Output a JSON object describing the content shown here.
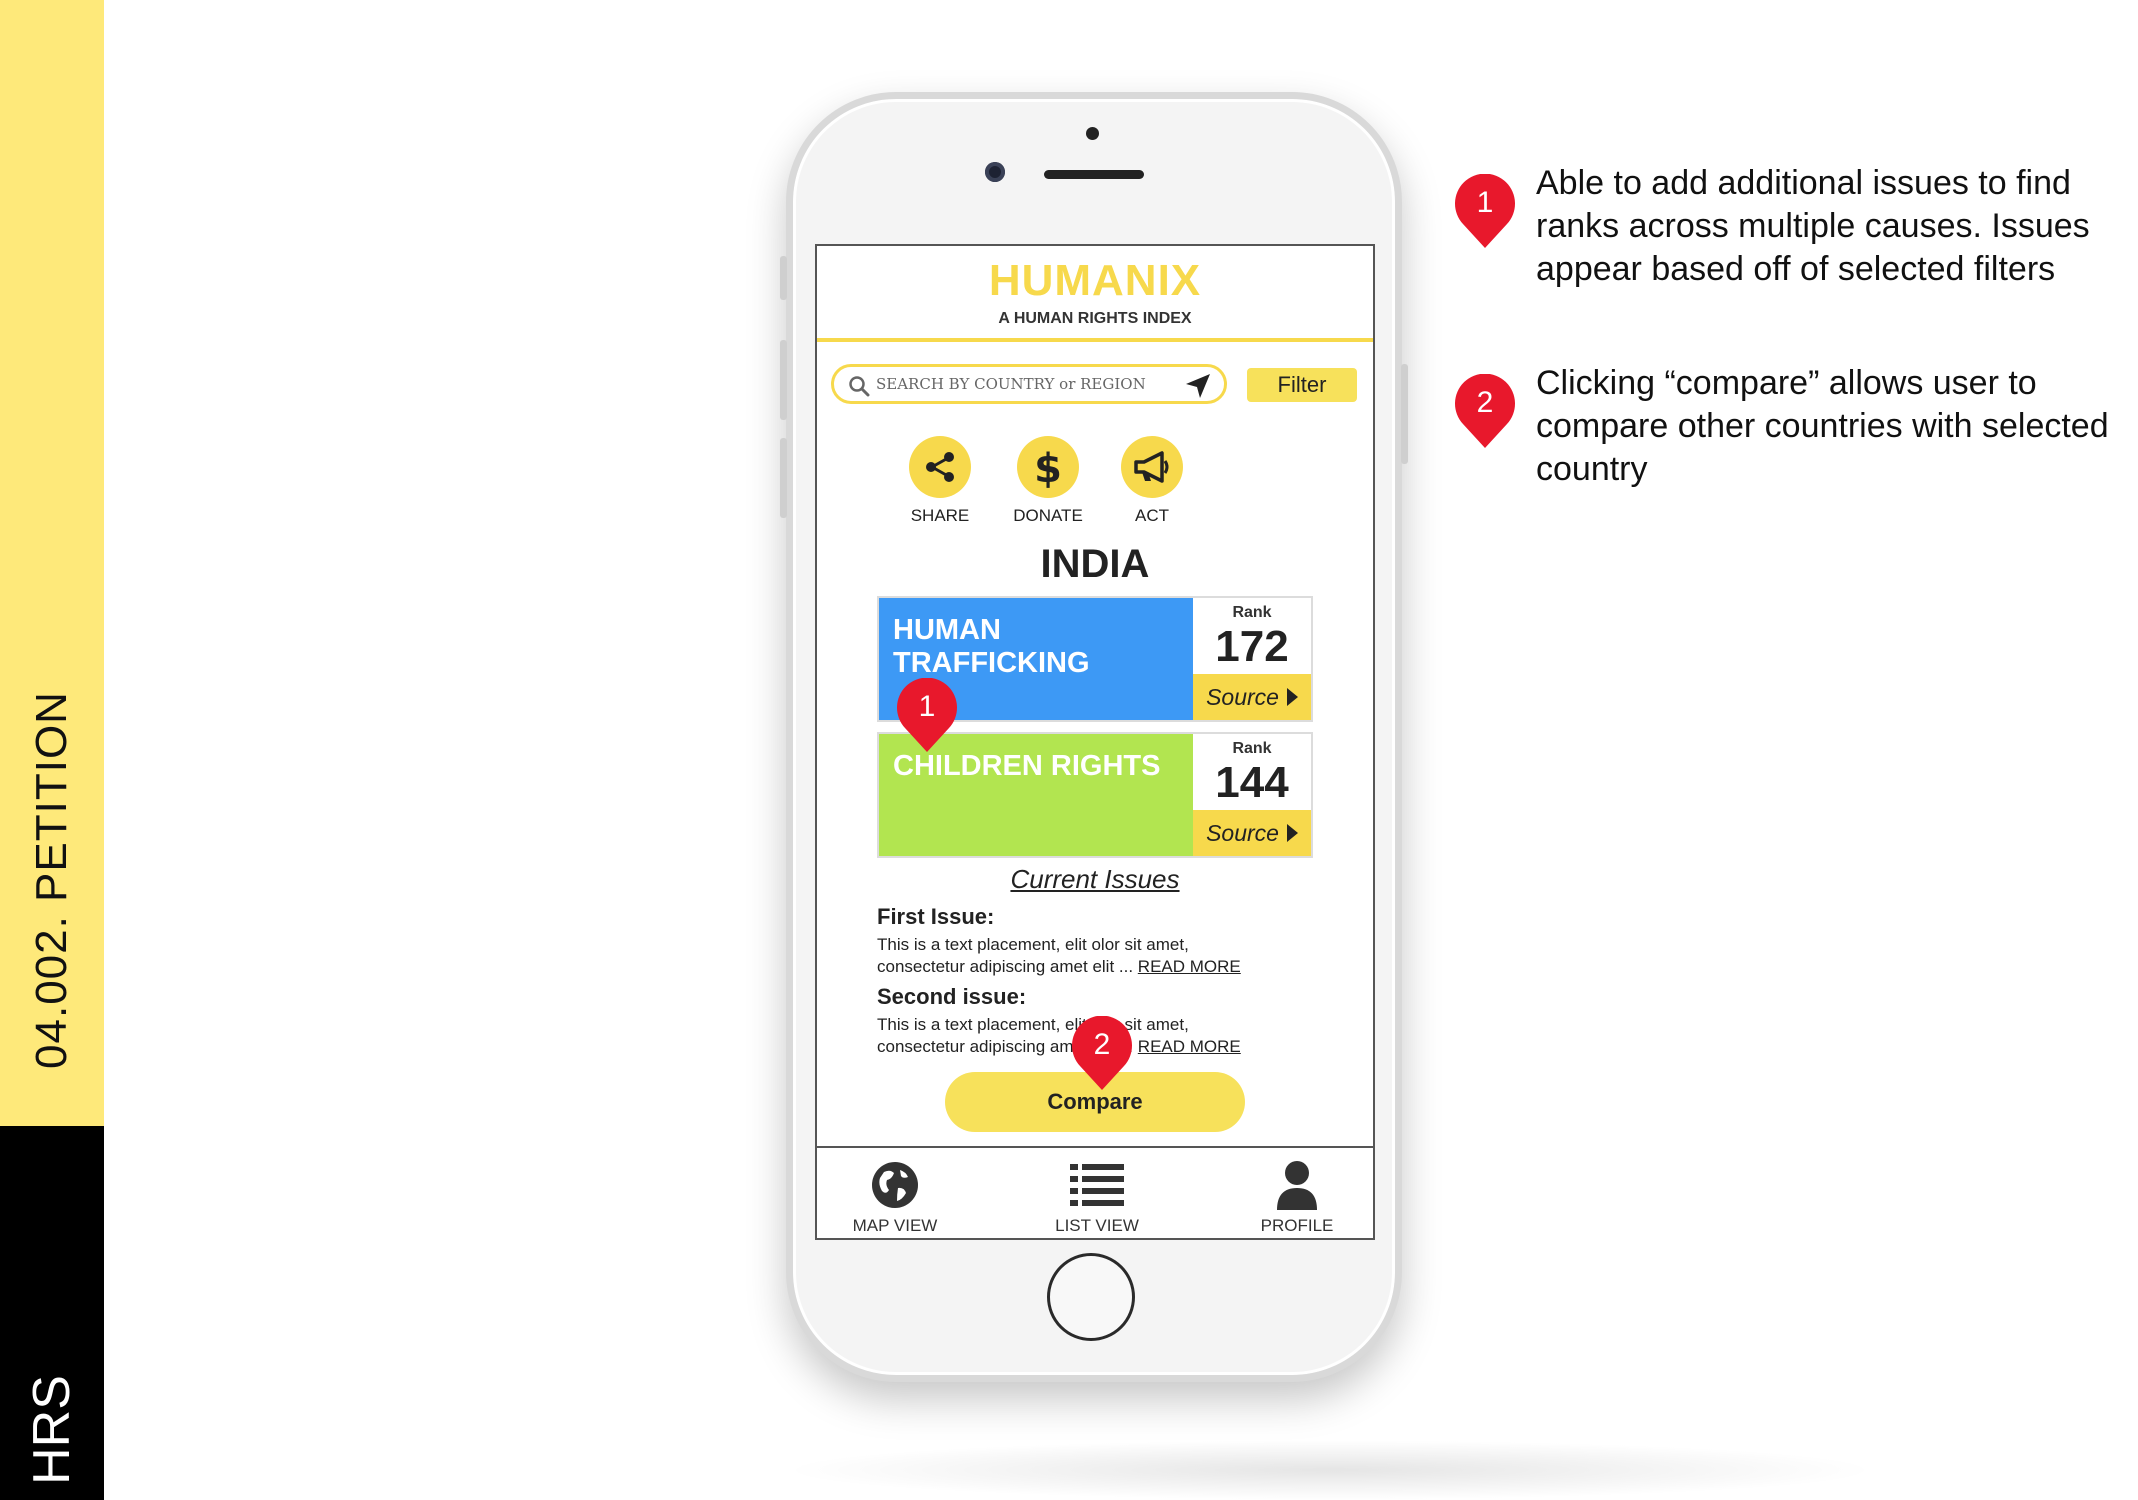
{
  "rail": {
    "section": "04.002. PETITION",
    "brand": "HRS"
  },
  "app": {
    "title": "HUMANIX",
    "subtitle": "A HUMAN RIGHTS INDEX"
  },
  "search": {
    "placeholder": "SEARCH BY COUNTRY or REGION",
    "filter_label": "Filter"
  },
  "actions": [
    {
      "label": "SHARE",
      "icon": "share-icon"
    },
    {
      "label": "DONATE",
      "icon": "dollar-icon"
    },
    {
      "label": "ACT",
      "icon": "megaphone-icon"
    }
  ],
  "country": "INDIA",
  "issues": [
    {
      "name": "HUMAN TRAFFICKING",
      "rank_label": "Rank",
      "rank": "172",
      "source_label": "Source",
      "color": "#3d99f5"
    },
    {
      "name": "CHILDREN RIGHTS",
      "rank_label": "Rank",
      "rank": "144",
      "source_label": "Source",
      "color": "#b2e550"
    }
  ],
  "current_issues": {
    "title": "Current Issues",
    "items": [
      {
        "heading": "First Issue:",
        "line1": "This is a text placement, elit olor sit amet,",
        "line2": "consectetur adipiscing amet elit ... ",
        "link": "READ MORE"
      },
      {
        "heading": "Second issue:",
        "line1": "This is a text placement, elit olor sit amet,",
        "line2": "consectetur adipiscing amet elit ... ",
        "link": "READ MORE"
      }
    ]
  },
  "compare_label": "Compare",
  "tabs": [
    {
      "label": "MAP VIEW",
      "icon": "globe-icon"
    },
    {
      "label": "LIST VIEW",
      "icon": "list-icon"
    },
    {
      "label": "PROFILE",
      "icon": "person-icon"
    }
  ],
  "annotations": [
    {
      "number": "1",
      "text": "Able to add additional issues to find ranks across multiple causes. Issues appear based off of selected filters"
    },
    {
      "number": "2",
      "text": "Clicking “compare” allows user to compare other countries with selected country"
    }
  ],
  "colors": {
    "accent_yellow": "#f7d94c",
    "rail_yellow": "#fee97a",
    "pin_red": "#e8182c"
  }
}
